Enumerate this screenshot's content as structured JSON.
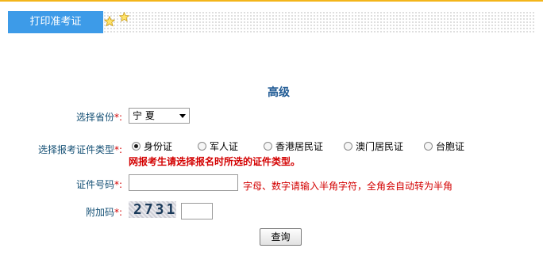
{
  "header": {
    "tab_label": "打印准考证"
  },
  "form": {
    "title": "高级",
    "province": {
      "label": "选择省份",
      "required_mark": "*:",
      "selected": "宁 夏"
    },
    "id_type": {
      "label": "选择报考证件类型",
      "required_mark": "*:",
      "options": [
        "身份证",
        "军人证",
        "香港居民证",
        "澳门居民证",
        "台胞证"
      ],
      "selected_index": 0,
      "warning": "网报考生请选择报名时所选的证件类型。"
    },
    "id_number": {
      "label": "证件号码",
      "required_mark": "*:",
      "value": "",
      "hint": "字母、数字请输入半角字符，全角会自动转为半角"
    },
    "captcha": {
      "label": "附加码",
      "required_mark": "*:",
      "image_text": "2731",
      "value": ""
    },
    "submit_label": "查询"
  },
  "colors": {
    "tab": "#3d9be8",
    "top_line": "#f3b51a",
    "title": "#1f5a94",
    "label": "#134f74",
    "required": "#d30000"
  },
  "icons": [
    "star-icon",
    "star-icon"
  ]
}
